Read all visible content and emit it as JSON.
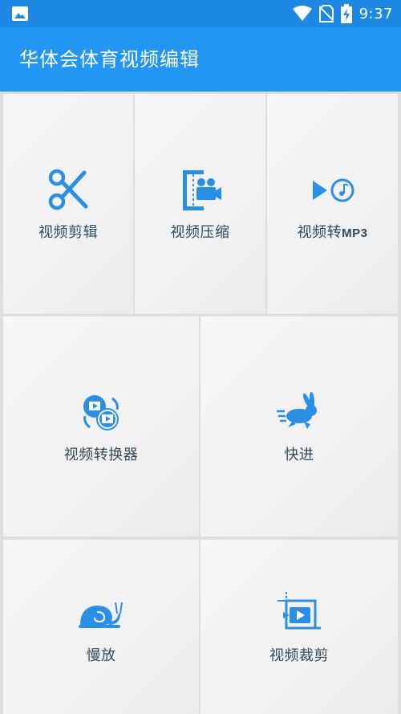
{
  "status_bar": {
    "time": "9:37",
    "icons": [
      "image-icon",
      "wifi-icon",
      "no-sim-icon",
      "battery-charging-icon"
    ]
  },
  "app_bar": {
    "title": "华体会体育视频编辑"
  },
  "tools": [
    {
      "id": "video-cut",
      "label": "视频剪辑",
      "icon": "scissors-icon"
    },
    {
      "id": "video-compress",
      "label": "视频压缩",
      "icon": "compress-camera-icon"
    },
    {
      "id": "video-to-mp3",
      "label_prefix": "视频转",
      "label_suffix": "MP3",
      "icon": "play-music-icon"
    },
    {
      "id": "video-converter",
      "label": "视频转换器",
      "icon": "convert-video-icon"
    },
    {
      "id": "fast-forward",
      "label": "快进",
      "icon": "rabbit-icon"
    },
    {
      "id": "slow-motion",
      "label": "慢放",
      "icon": "snail-icon"
    },
    {
      "id": "video-crop",
      "label": "视频裁剪",
      "icon": "crop-video-icon"
    }
  ],
  "colors": {
    "status_bar": "#1e88e5",
    "app_bar": "#2196f3",
    "icon": "#2a8fe6",
    "label": "#2f4a5a"
  }
}
